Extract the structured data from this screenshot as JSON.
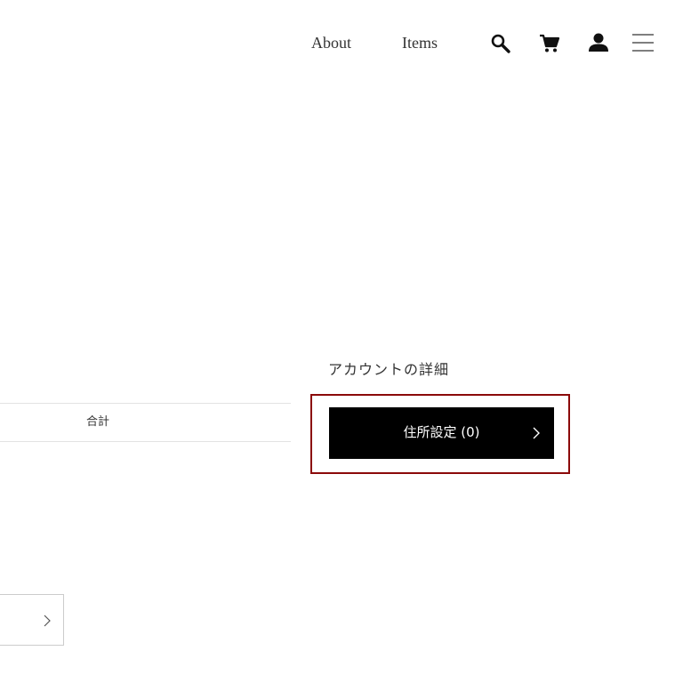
{
  "header": {
    "nav": [
      {
        "label": "About"
      },
      {
        "label": "Items"
      }
    ],
    "icons": [
      "search-icon",
      "cart-icon",
      "user-icon",
      "menu-icon"
    ]
  },
  "account": {
    "heading": "アカウントの詳細",
    "address_button_label": "住所設定 (0)"
  },
  "orders_table": {
    "columns": [
      "合計"
    ]
  },
  "colors": {
    "button_background": "#000000",
    "button_text": "#ffffff",
    "highlight_border": "#8b0a0a",
    "divider": "#e3e3e3"
  }
}
